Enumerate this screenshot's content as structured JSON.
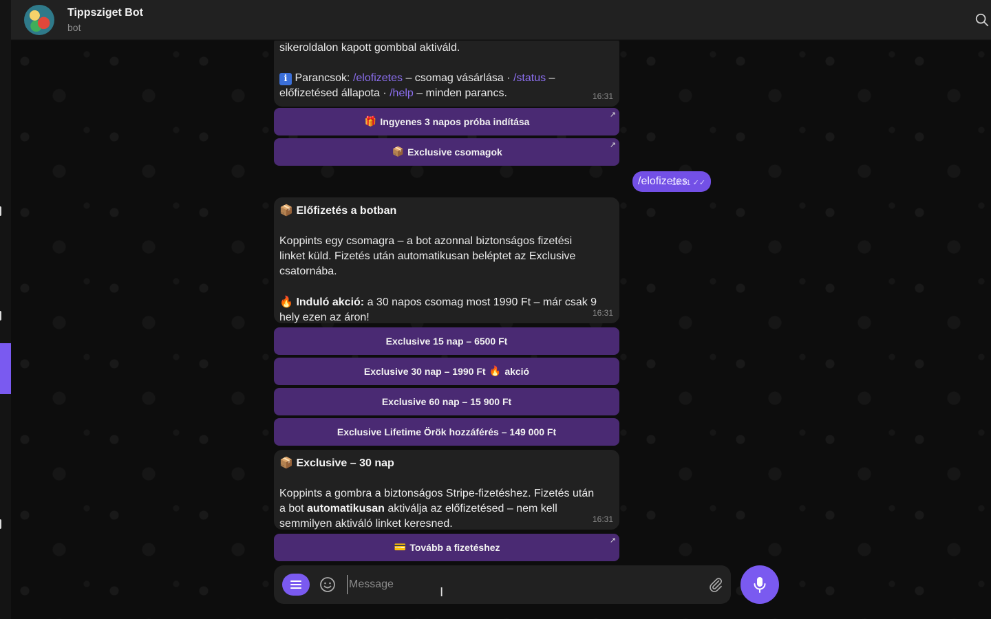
{
  "header": {
    "title": "Tippsziget Bot",
    "subtitle": "bot"
  },
  "messages": {
    "m1": {
      "line1": "sikeroldalon kapott gombbal aktiváld.",
      "commands_icon": "ℹ",
      "commands_label": "Parancsok:",
      "cmd_elofizetes": "/elofizetes",
      "cmd_elofizetes_desc": " – csomag vásárlása · ",
      "cmd_status": "/status",
      "cmd_status_desc": " –",
      "line3_prefix": "előfizetésed állapota · ",
      "cmd_help": "/help",
      "cmd_help_desc": " – minden parancs.",
      "time": "16:31"
    },
    "m1_buttons": [
      {
        "icon": "🎁",
        "label": "Ingyenes 3 napos próba indítása"
      },
      {
        "icon": "📦",
        "label": "Exclusive csomagok"
      }
    ],
    "outgoing": {
      "text": "/elofizetes",
      "time": "16:31"
    },
    "m2": {
      "title_icon": "📦",
      "title": "Előfizetés a botban",
      "para1_l1": "Koppints egy csomagra – a bot azonnal biztonságos fizetési",
      "para1_l2": "linket küld. Fizetés után automatikusan beléptet az Exclusive",
      "para1_l3": "csatornába.",
      "promo_icon": "🔥",
      "promo_label": "Induló akció:",
      "promo_l1": " a 30 napos csomag most 1990 Ft – már csak 9",
      "promo_l2": "hely ezen az áron!",
      "time": "16:31"
    },
    "m2_buttons": [
      {
        "label": "Exclusive 15 nap – 6500 Ft",
        "icon": ""
      },
      {
        "label": "Exclusive 30 nap – 1990 Ft",
        "icon": "🔥",
        "suffix": "akció"
      },
      {
        "label": "Exclusive 60 nap – 15 900 Ft",
        "icon": ""
      },
      {
        "label": "Exclusive Lifetime Örök hozzáférés – 149 000 Ft",
        "icon": ""
      }
    ],
    "m3": {
      "title_icon": "📦",
      "title": "Exclusive – 30 nap",
      "l1": "Koppints a gombra a biztonságos Stripe-fizetéshez. Fizetés után",
      "l2_prefix": "a bot ",
      "l2_bold": "automatikusan",
      "l2_suffix": " aktiválja az előfizetésed – nem kell",
      "l3": "semmilyen aktiváló linket keresned.",
      "time": "16:31"
    },
    "m3_buttons": [
      {
        "icon": "💳",
        "label": "Tovább a fizetéshez"
      }
    ]
  },
  "composer": {
    "placeholder": "Message"
  },
  "icons": {
    "search": "search-icon",
    "menu": "menu-icon",
    "emoji": "smiley-icon",
    "attach": "paperclip-icon",
    "mic": "microphone-icon",
    "external": "external-link-arrow-icon"
  },
  "colors": {
    "accent": "#7a5af0",
    "button_bg": "#4a2a73",
    "bubble_in": "#212121",
    "bubble_out": "#7350e6",
    "link": "#8c6ff0"
  }
}
